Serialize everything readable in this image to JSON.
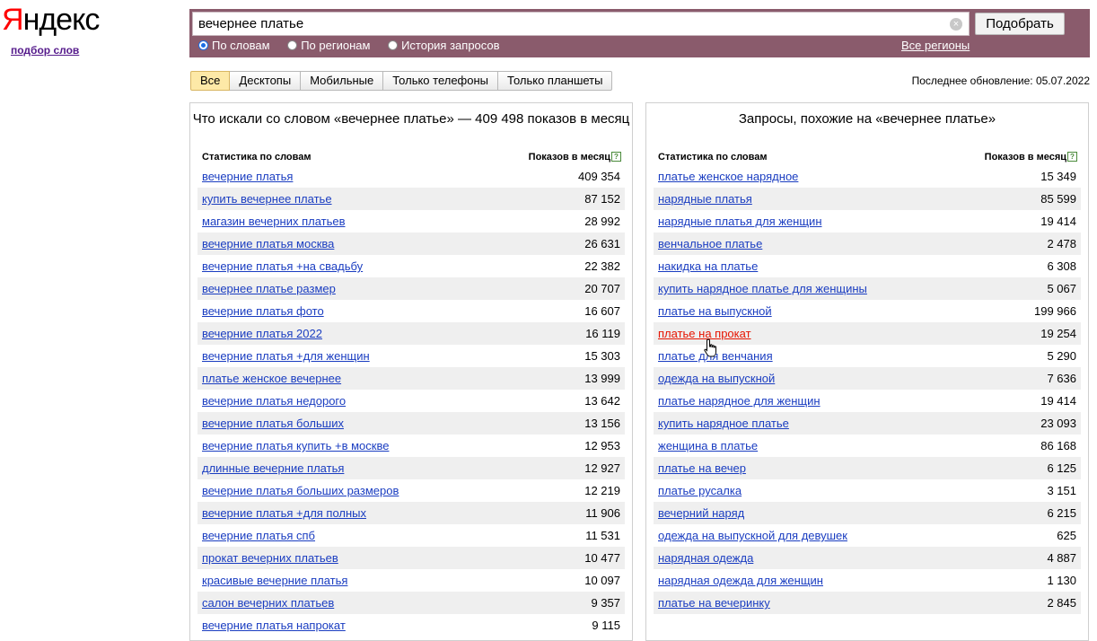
{
  "logo": {
    "red": "Я",
    "rest": "ндекс"
  },
  "service_link": "подбор слов",
  "search": {
    "value": "вечернее платье",
    "submit": "Подобрать",
    "clear": "×"
  },
  "radios": [
    "По словам",
    "По регионам",
    "История запросов"
  ],
  "regions_link": "Все регионы",
  "tabs": [
    "Все",
    "Десктопы",
    "Мобильные",
    "Только телефоны",
    "Только планшеты"
  ],
  "updated": "Последнее обновление: 05.07.2022",
  "left": {
    "title": "Что искали со словом «вечернее платье» — 409 498 показов в месяц",
    "col_words": "Статистика по словам",
    "col_count": "Показов в месяц",
    "rows": [
      [
        "вечерние платья",
        "409 354"
      ],
      [
        "купить вечернее платье",
        "87 152"
      ],
      [
        "магазин вечерних платьев",
        "28 992"
      ],
      [
        "вечерние платья москва",
        "26 631"
      ],
      [
        "вечерние платья +на свадьбу",
        "22 382"
      ],
      [
        "вечернее платье размер",
        "20 707"
      ],
      [
        "вечерние платья фото",
        "16 607"
      ],
      [
        "вечерние платья 2022",
        "16 119"
      ],
      [
        "вечерние платья +для женщин",
        "15 303"
      ],
      [
        "платье женское вечернее",
        "13 999"
      ],
      [
        "вечерние платья недорого",
        "13 642"
      ],
      [
        "вечерние платья больших",
        "13 156"
      ],
      [
        "вечерние платья купить +в москве",
        "12 953"
      ],
      [
        "длинные вечерние платья",
        "12 927"
      ],
      [
        "вечерние платья больших размеров",
        "12 219"
      ],
      [
        "вечерние платья +для полных",
        "11 906"
      ],
      [
        "вечерние платья спб",
        "11 531"
      ],
      [
        "прокат вечерних платьев",
        "10 477"
      ],
      [
        "красивые вечерние платья",
        "10 097"
      ],
      [
        "салон вечерних платьев",
        "9 357"
      ],
      [
        "вечерние платья напрокат",
        "9 115"
      ]
    ]
  },
  "right": {
    "title": "Запросы, похожие на «вечернее платье»",
    "col_words": "Статистика по словам",
    "col_count": "Показов в месяц",
    "rows": [
      [
        "платье женское нарядное",
        "15 349"
      ],
      [
        "нарядные платья",
        "85 599"
      ],
      [
        "нарядные платья для женщин",
        "19 414"
      ],
      [
        "венчальное платье",
        "2 478"
      ],
      [
        "накидка на платье",
        "6 308"
      ],
      [
        "купить нарядное платье для женщины",
        "5 067"
      ],
      [
        "платье на выпускной",
        "199 966"
      ],
      [
        "платье на прокат",
        "19 254"
      ],
      [
        "платье для венчания",
        "5 290"
      ],
      [
        "одежда на выпускной",
        "7 636"
      ],
      [
        "платье нарядное для женщин",
        "19 414"
      ],
      [
        "купить нарядное платье",
        "23 093"
      ],
      [
        "женщина в платье",
        "86 168"
      ],
      [
        "платье на вечер",
        "6 125"
      ],
      [
        "платье русалка",
        "3 151"
      ],
      [
        "вечерний наряд",
        "6 215"
      ],
      [
        "одежда на выпускной для девушек",
        "625"
      ],
      [
        "нарядная одежда",
        "4 887"
      ],
      [
        "нарядная одежда для женщин",
        "1 130"
      ],
      [
        "платье на вечеринку",
        "2 845"
      ]
    ],
    "hovered_index": 7
  }
}
